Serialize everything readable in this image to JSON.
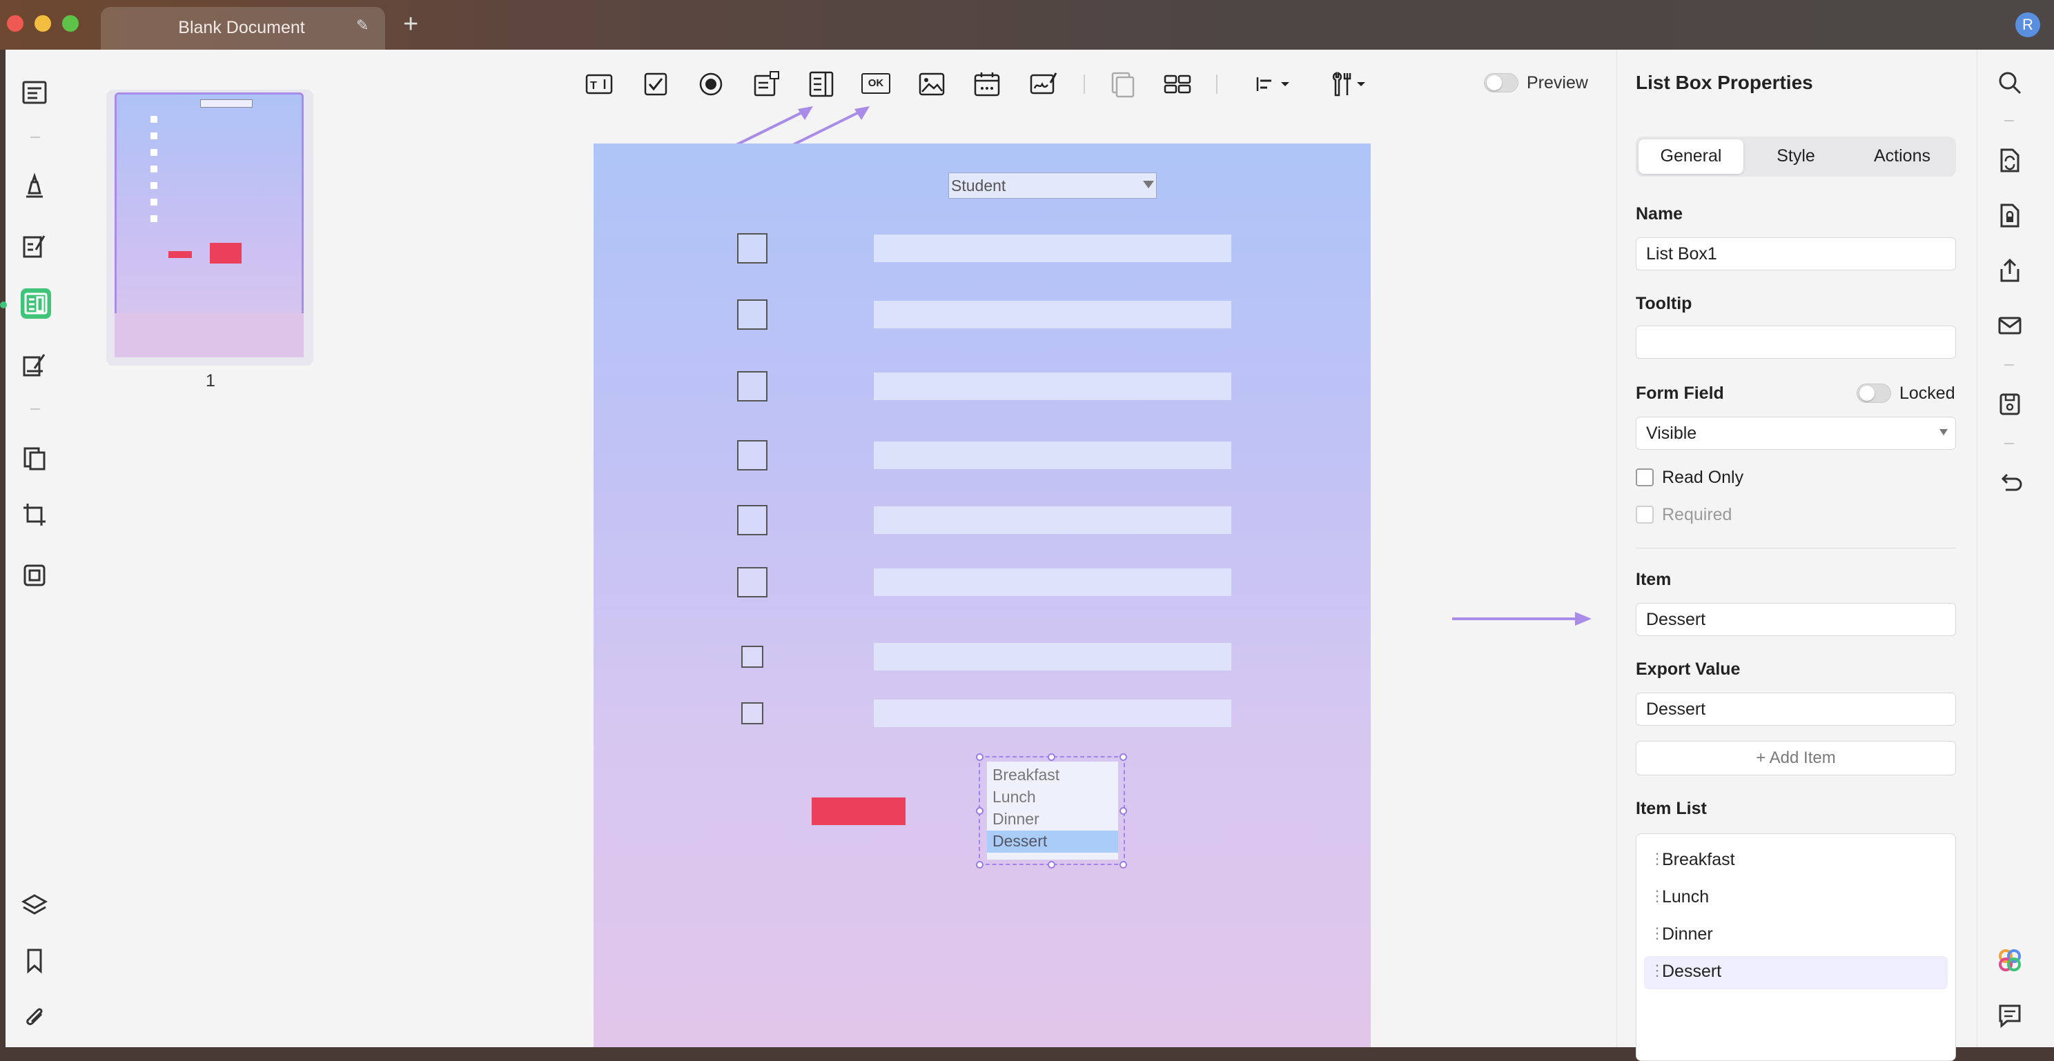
{
  "window": {
    "tab_title": "Blank Document",
    "avatar_letter": "R"
  },
  "thumbnails": {
    "page_number": "1"
  },
  "toolbar": {
    "preview_label": "Preview",
    "ok_label": "OK"
  },
  "page": {
    "combo_value": "Student",
    "listbox_items": [
      "Breakfast",
      "Lunch",
      "Dinner",
      "Dessert"
    ],
    "listbox_selected": "Dessert"
  },
  "props": {
    "title": "List Box Properties",
    "tabs": [
      "General",
      "Style",
      "Actions"
    ],
    "active_tab": "General",
    "name_label": "Name",
    "name_value": "List Box1",
    "tooltip_label": "Tooltip",
    "tooltip_value": "",
    "form_field_label": "Form Field",
    "locked_label": "Locked",
    "visibility_value": "Visible",
    "read_only_label": "Read Only",
    "required_label": "Required",
    "item_label": "Item",
    "item_value": "Dessert",
    "export_label": "Export Value",
    "export_value": "Dessert",
    "add_item_label": "+ Add Item",
    "item_list_label": "Item List",
    "item_list": [
      "Breakfast",
      "Lunch",
      "Dinner",
      "Dessert"
    ]
  },
  "colors": {
    "accent": "#a98be8",
    "active_green": "#3fc47a",
    "button_red": "#ec3f5b",
    "selection_blue": "#a9cdf6"
  }
}
